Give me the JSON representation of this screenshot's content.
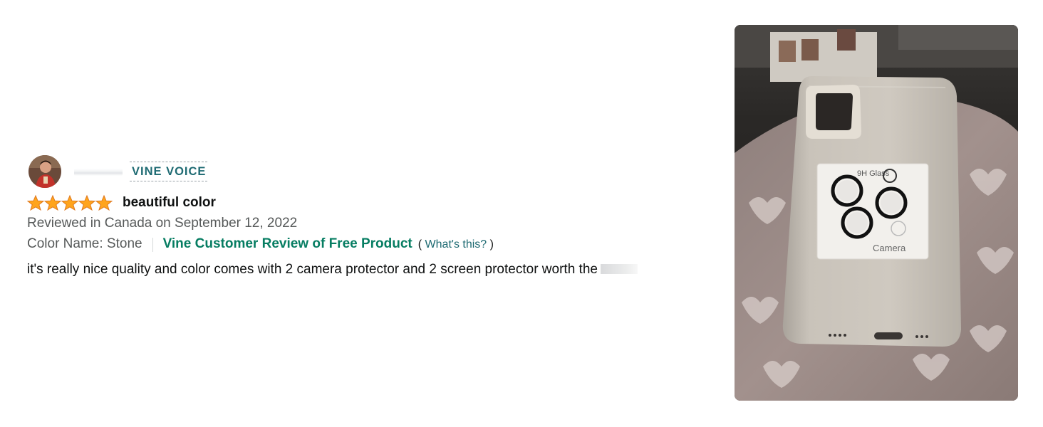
{
  "review": {
    "vine_badge": "VINE VOICE",
    "rating": 5,
    "rating_max": 5,
    "title": "beautiful color",
    "date_line": "Reviewed in Canada on September 12, 2022",
    "color_name": "Color Name: Stone",
    "vine_label": "Vine Customer Review of Free Product",
    "whats_this_open": "(",
    "whats_this_link": "What's this?",
    "whats_this_close": ")",
    "body": "it's really nice quality and color comes with 2 camera protector and 2 screen protector worth the"
  },
  "photo": {
    "camera_label": "Camera",
    "lens_brand_text": "9H Glass"
  },
  "colors": {
    "star": "#FFA41C",
    "vine_green": "#067D62",
    "link_teal": "#1f6b73",
    "secondary_text": "#565959"
  }
}
